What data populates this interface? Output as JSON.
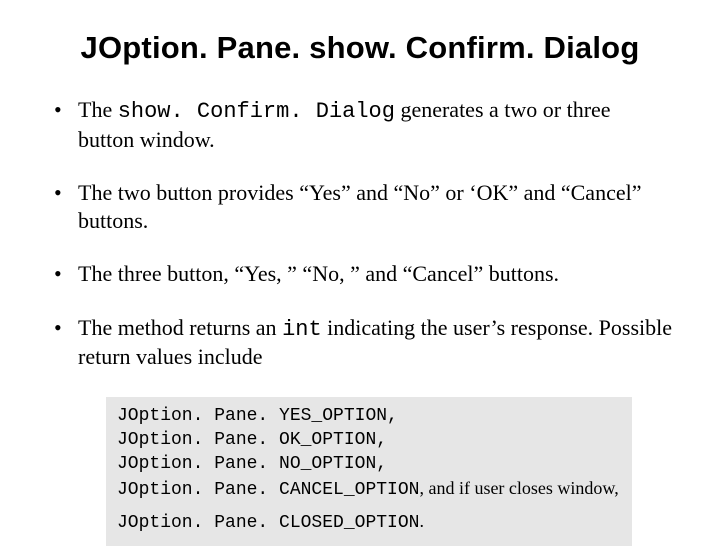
{
  "title": "JOption. Pane. show. Confirm. Dialog",
  "bullets": {
    "b1a": "The ",
    "b1code": "show. Confirm. Dialog",
    "b1b": " generates a two or three button window.",
    "b2": "The two button provides “Yes” and “No” or ‘OK” and “Cancel” buttons.",
    "b3": "The three button, “Yes, ” “No, ” and “Cancel” buttons.",
    "b4a": "The method returns an ",
    "b4code": "int",
    "b4b": " indicating the user’s response. Possible return values include"
  },
  "code": {
    "l1": "JOption. Pane. YES_OPTION,",
    "l2": "JOption. Pane. OK_OPTION,",
    "l3": "JOption. Pane. NO_OPTION,",
    "l4code": "JOption. Pane. CANCEL_OPTION",
    "l4tail": ", and if user closes window,",
    "l5code": "JOption. Pane. CLOSED_OPTION",
    "l5tail": "."
  }
}
